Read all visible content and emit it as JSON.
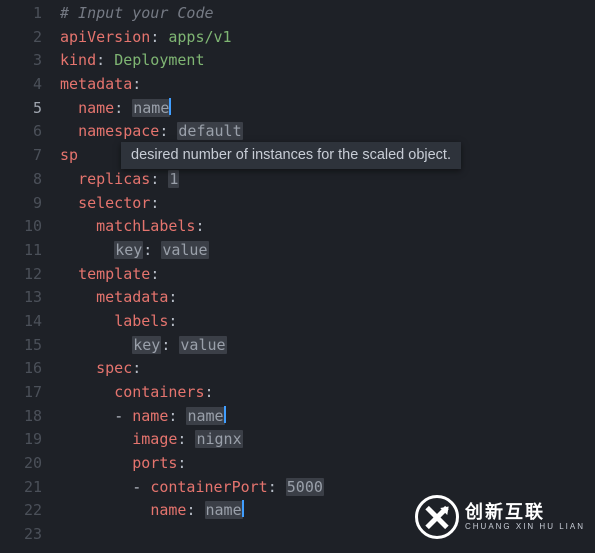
{
  "editor": {
    "active_line": 5,
    "tooltip": "desired number of instances for the scaled object.",
    "lines": [
      {
        "num": 1,
        "indent": 0,
        "segments": [
          {
            "t": "comment",
            "v": "# Input your Code"
          }
        ]
      },
      {
        "num": 2,
        "indent": 0,
        "segments": [
          {
            "t": "key",
            "v": "apiVersion"
          },
          {
            "t": "colon",
            "v": ": "
          },
          {
            "t": "str",
            "v": "apps/v1"
          }
        ]
      },
      {
        "num": 3,
        "indent": 0,
        "segments": [
          {
            "t": "key",
            "v": "kind"
          },
          {
            "t": "colon",
            "v": ": "
          },
          {
            "t": "str",
            "v": "Deployment"
          }
        ]
      },
      {
        "num": 4,
        "indent": 0,
        "segments": [
          {
            "t": "key",
            "v": "metadata"
          },
          {
            "t": "colon",
            "v": ":"
          }
        ]
      },
      {
        "num": 5,
        "indent": 1,
        "segments": [
          {
            "t": "key",
            "v": "name"
          },
          {
            "t": "colon",
            "v": ": "
          },
          {
            "t": "placeholder",
            "v": "name",
            "cursor": true
          }
        ]
      },
      {
        "num": 6,
        "indent": 1,
        "segments": [
          {
            "t": "key",
            "v": "namespace"
          },
          {
            "t": "colon",
            "v": ": "
          },
          {
            "t": "placeholder",
            "v": "default"
          }
        ]
      },
      {
        "num": 7,
        "indent": 0,
        "segments": [
          {
            "t": "key",
            "v": "sp"
          }
        ]
      },
      {
        "num": 8,
        "indent": 1,
        "segments": [
          {
            "t": "key",
            "v": "replicas"
          },
          {
            "t": "colon",
            "v": ": "
          },
          {
            "t": "placeholder",
            "v": "1"
          }
        ]
      },
      {
        "num": 9,
        "indent": 1,
        "segments": [
          {
            "t": "key",
            "v": "selector"
          },
          {
            "t": "colon",
            "v": ":"
          }
        ]
      },
      {
        "num": 10,
        "indent": 2,
        "segments": [
          {
            "t": "key",
            "v": "matchLabels"
          },
          {
            "t": "colon",
            "v": ":"
          }
        ]
      },
      {
        "num": 11,
        "indent": 3,
        "segments": [
          {
            "t": "placeholder",
            "v": "key"
          },
          {
            "t": "colon",
            "v": ": "
          },
          {
            "t": "placeholder",
            "v": "value"
          }
        ]
      },
      {
        "num": 12,
        "indent": 1,
        "segments": [
          {
            "t": "key",
            "v": "template"
          },
          {
            "t": "colon",
            "v": ":"
          }
        ]
      },
      {
        "num": 13,
        "indent": 2,
        "segments": [
          {
            "t": "key",
            "v": "metadata"
          },
          {
            "t": "colon",
            "v": ":"
          }
        ]
      },
      {
        "num": 14,
        "indent": 3,
        "segments": [
          {
            "t": "key",
            "v": "labels"
          },
          {
            "t": "colon",
            "v": ":"
          }
        ]
      },
      {
        "num": 15,
        "indent": 4,
        "segments": [
          {
            "t": "placeholder",
            "v": "key"
          },
          {
            "t": "colon",
            "v": ": "
          },
          {
            "t": "placeholder",
            "v": "value"
          }
        ]
      },
      {
        "num": 16,
        "indent": 2,
        "segments": [
          {
            "t": "key",
            "v": "spec"
          },
          {
            "t": "colon",
            "v": ":"
          }
        ]
      },
      {
        "num": 17,
        "indent": 3,
        "segments": [
          {
            "t": "key",
            "v": "containers"
          },
          {
            "t": "colon",
            "v": ":"
          }
        ]
      },
      {
        "num": 18,
        "indent": 3,
        "segments": [
          {
            "t": "dash",
            "v": "- "
          },
          {
            "t": "key",
            "v": "name"
          },
          {
            "t": "colon",
            "v": ": "
          },
          {
            "t": "placeholder",
            "v": "name",
            "cursor": true
          }
        ]
      },
      {
        "num": 19,
        "indent": 4,
        "segments": [
          {
            "t": "key",
            "v": "image"
          },
          {
            "t": "colon",
            "v": ": "
          },
          {
            "t": "placeholder",
            "v": "nignx"
          }
        ]
      },
      {
        "num": 20,
        "indent": 4,
        "segments": [
          {
            "t": "key",
            "v": "ports"
          },
          {
            "t": "colon",
            "v": ":"
          }
        ]
      },
      {
        "num": 21,
        "indent": 4,
        "segments": [
          {
            "t": "dash",
            "v": "- "
          },
          {
            "t": "key",
            "v": "containerPort"
          },
          {
            "t": "colon",
            "v": ": "
          },
          {
            "t": "placeholder",
            "v": "5000"
          }
        ]
      },
      {
        "num": 22,
        "indent": 5,
        "segments": [
          {
            "t": "key",
            "v": "name"
          },
          {
            "t": "colon",
            "v": ": "
          },
          {
            "t": "placeholder",
            "v": "name",
            "cursor": true
          }
        ]
      },
      {
        "num": 23,
        "indent": 0,
        "segments": []
      }
    ]
  },
  "watermark": {
    "title": "创新互联",
    "subtitle": "CHUANG XIN HU LIAN"
  }
}
